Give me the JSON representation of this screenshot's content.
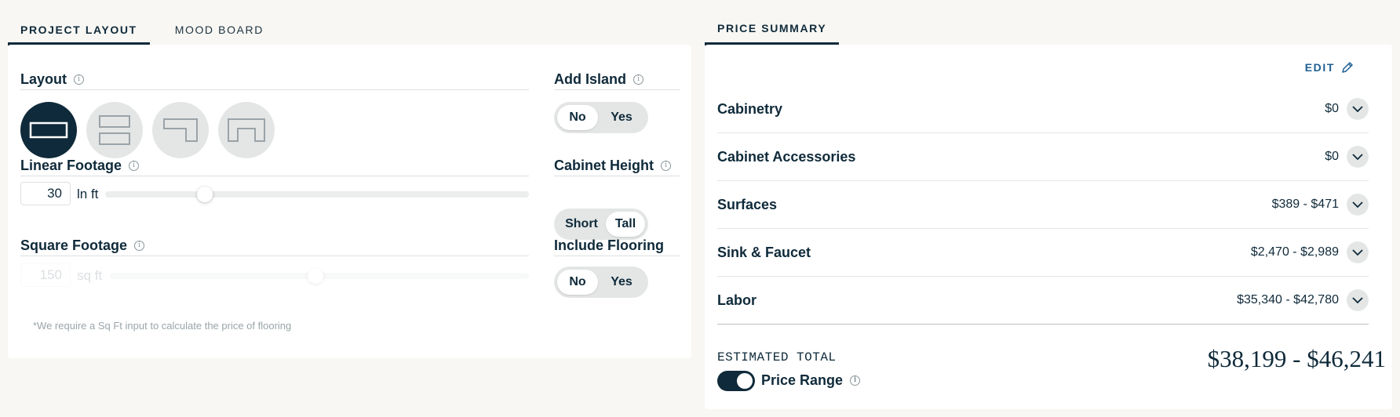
{
  "left_tabs": [
    {
      "label": "PROJECT LAYOUT",
      "active": true
    },
    {
      "label": "MOOD BOARD",
      "active": false
    }
  ],
  "right_tabs": [
    {
      "label": "PRICE SUMMARY",
      "active": true
    }
  ],
  "layout": {
    "label": "Layout",
    "options": [
      {
        "icon": "single-wall-layout-icon",
        "selected": true
      },
      {
        "icon": "galley-layout-icon",
        "selected": false
      },
      {
        "icon": "l-shape-layout-icon",
        "selected": false
      },
      {
        "icon": "u-shape-layout-icon",
        "selected": false
      }
    ]
  },
  "linear_footage": {
    "label": "Linear Footage",
    "value": "30",
    "unit": "ln ft",
    "slider_fraction": 0.235
  },
  "square_footage": {
    "label": "Square Footage",
    "value": "150",
    "unit": "sq ft",
    "slider_fraction": 0.49,
    "note": "*We require a Sq Ft input to calculate the price of flooring"
  },
  "add_island": {
    "label": "Add Island",
    "options": [
      "No",
      "Yes"
    ],
    "selected": "No"
  },
  "cabinet_height": {
    "label": "Cabinet Height",
    "options": [
      "Short",
      "Tall"
    ],
    "selected": "Tall"
  },
  "include_flooring": {
    "label": "Include Flooring",
    "options": [
      "No",
      "Yes"
    ],
    "selected": "No"
  },
  "summary": {
    "edit_label": "EDIT",
    "rows": [
      {
        "name": "Cabinetry",
        "price": "$0"
      },
      {
        "name": "Cabinet Accessories",
        "price": "$0"
      },
      {
        "name": "Surfaces",
        "price": "$389 - $471"
      },
      {
        "name": "Sink & Faucet",
        "price": "$2,470 - $2,989"
      },
      {
        "name": "Labor",
        "price": "$35,340 - $42,780"
      }
    ],
    "estimated_total_label": "ESTIMATED TOTAL",
    "estimated_total": "$38,199 - $46,241",
    "price_range_label": "Price Range",
    "price_range_on": true
  },
  "colors": {
    "primary": "#0f2a3a",
    "accent": "#1f5f94",
    "page_bg": "#f8f7f3",
    "pill_bg": "#e4e6e6"
  }
}
